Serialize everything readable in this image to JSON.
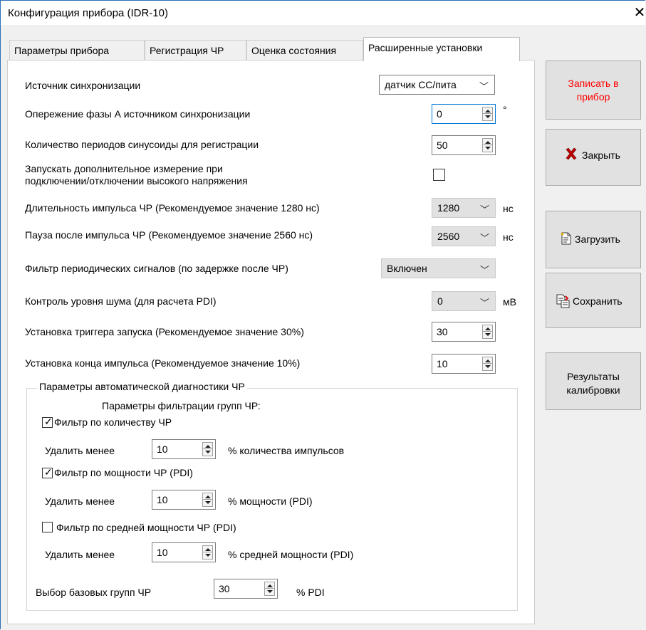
{
  "window": {
    "title": "Конфигурация прибора (IDR-10)",
    "close_glyph": "✕"
  },
  "tabs": [
    {
      "label": "Параметры прибора"
    },
    {
      "label": "Регистрация ЧР"
    },
    {
      "label": "Оценка состояния"
    },
    {
      "label": "Расширенные установки",
      "active": true
    }
  ],
  "settings": {
    "sync_source": {
      "label": "Источник синхронизации",
      "value": "датчик СС/пита"
    },
    "phase_advance": {
      "label": "Опережение фазы А источником синхронизации",
      "value": "0",
      "unit": "°"
    },
    "periods": {
      "label": "Количество периодов синусоиды для регистрации",
      "value": "50"
    },
    "extra_measure": {
      "label_line1": "Запускать дополнительное измерение при",
      "label_line2": "подключении/отключении высокого напряжения",
      "checked": false
    },
    "pulse_duration": {
      "label": "Длительность импульса ЧР  (Рекомендуемое значение 1280 нс)",
      "value": "1280",
      "unit": "нс"
    },
    "pulse_pause": {
      "label": "Пауза после импульса ЧР  (Рекомендуемое значение 2560 нс)",
      "value": "2560",
      "unit": "нс"
    },
    "periodic_filter": {
      "label": "Фильтр периодических сигналов (по задержке после ЧР)",
      "value": "Включен"
    },
    "noise_control": {
      "label": "Контроль уровня шума (для расчета PDI)",
      "value": "0",
      "unit": "мВ"
    },
    "trigger": {
      "label": "Установка триггера запуска (Рекомендуемое значение 30%)",
      "value": "30"
    },
    "pulse_end": {
      "label": "Установка конца импульса (Рекомендуемое значение 10%)",
      "value": "10"
    }
  },
  "auto_diag": {
    "legend": "Параметры автоматической диагностики ЧР",
    "subtitle": "Параметры фильтрации групп ЧР:",
    "filters": [
      {
        "label": "Фильтр по количеству ЧР",
        "checked": true,
        "remove_label": "Удалить менее",
        "value": "10",
        "unit": "% количества импульсов"
      },
      {
        "label": "Фильтр по мощности ЧР (PDI)",
        "checked": true,
        "remove_label": "Удалить менее",
        "value": "10",
        "unit": "% мощности (PDI)"
      },
      {
        "label": "Фильтр по средней мощности ЧР (PDI)",
        "checked": false,
        "remove_label": "Удалить менее",
        "value": "10",
        "unit": "% средней мощности (PDI)"
      }
    ],
    "base_groups": {
      "label": "Выбор базовых групп ЧР",
      "value": "30",
      "unit": "% PDI"
    }
  },
  "side_buttons": {
    "write": {
      "line1": "Записать в",
      "line2": "прибор",
      "color": "#ff0000"
    },
    "close": {
      "label": "Закрыть",
      "icon": "red-x-icon",
      "color": "#c00000"
    },
    "load": {
      "label": "Загрузить",
      "icon": "document-load-icon"
    },
    "save": {
      "label": "Сохранить",
      "icon": "document-save-icon"
    },
    "calib": {
      "line1": "Результаты",
      "line2": "калибровки"
    }
  },
  "glyphs": {
    "chevron": "﹀",
    "check": "✓"
  }
}
